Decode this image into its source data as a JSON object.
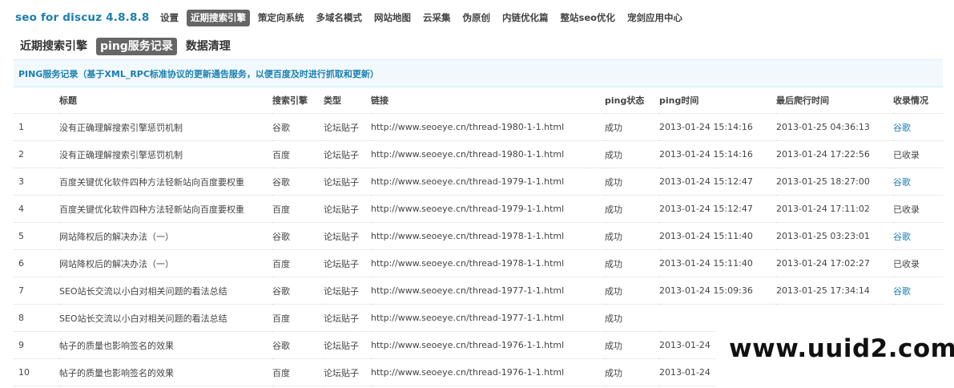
{
  "brand": "seo for discuz 4.8.8.8",
  "topnav": [
    "设置",
    "近期搜索引擎",
    "策定向系统",
    "多域名模式",
    "网站地图",
    "云采集",
    "伪原创",
    "内链优化篇",
    "整站seo优化",
    "宠剑应用中心"
  ],
  "topnav_active_index": 1,
  "subnav": [
    "近期搜索引擎",
    "ping服务记录",
    "数据清理"
  ],
  "subnav_active_index": 1,
  "info": "PING服务记录（基于XML_RPC标准协议的更新通告服务，以便百度及时进行抓取和更新）",
  "table": {
    "headers": {
      "idx": "",
      "title": "标题",
      "engine": "搜索引擎",
      "type": "类型",
      "link": "链接",
      "status": "ping状态",
      "ping_time": "ping时间",
      "crawl_time": "最后爬行时间",
      "recorded": "收录情况"
    },
    "rows": [
      {
        "idx": "1",
        "title": "没有正确理解搜索引擎惩罚机制",
        "engine": "谷歌",
        "type": "论坛贴子",
        "link": "http://www.seoeye.cn/thread-1980-1-1.html",
        "status": "成功",
        "ping_time": "2013-01-24 15:14:16",
        "crawl_time": "2013-01-25 04:36:13",
        "recorded": "谷歌"
      },
      {
        "idx": "2",
        "title": "没有正确理解搜索引擎惩罚机制",
        "engine": "百度",
        "type": "论坛贴子",
        "link": "http://www.seoeye.cn/thread-1980-1-1.html",
        "status": "成功",
        "ping_time": "2013-01-24 15:14:16",
        "crawl_time": "2013-01-24 17:22:56",
        "recorded": "已收录"
      },
      {
        "idx": "3",
        "title": "百度关键优化软件四种方法轻新站向百度要权重",
        "engine": "谷歌",
        "type": "论坛贴子",
        "link": "http://www.seoeye.cn/thread-1979-1-1.html",
        "status": "成功",
        "ping_time": "2013-01-24 15:12:47",
        "crawl_time": "2013-01-25 18:27:00",
        "recorded": "谷歌"
      },
      {
        "idx": "4",
        "title": "百度关键优化软件四种方法轻新站向百度要权重",
        "engine": "百度",
        "type": "论坛贴子",
        "link": "http://www.seoeye.cn/thread-1979-1-1.html",
        "status": "成功",
        "ping_time": "2013-01-24 15:12:47",
        "crawl_time": "2013-01-24 17:11:02",
        "recorded": "已收录"
      },
      {
        "idx": "5",
        "title": "网站降权后的解决办法（一）",
        "engine": "谷歌",
        "type": "论坛贴子",
        "link": "http://www.seoeye.cn/thread-1978-1-1.html",
        "status": "成功",
        "ping_time": "2013-01-24 15:11:40",
        "crawl_time": "2013-01-25 03:23:01",
        "recorded": "谷歌"
      },
      {
        "idx": "6",
        "title": "网站降权后的解决办法（一）",
        "engine": "百度",
        "type": "论坛贴子",
        "link": "http://www.seoeye.cn/thread-1978-1-1.html",
        "status": "成功",
        "ping_time": "2013-01-24 15:11:40",
        "crawl_time": "2013-01-24 17:02:27",
        "recorded": "已收录"
      },
      {
        "idx": "7",
        "title": "SEO站长交流以小白对相关问题的看法总结",
        "engine": "谷歌",
        "type": "论坛贴子",
        "link": "http://www.seoeye.cn/thread-1977-1-1.html",
        "status": "成功",
        "ping_time": "2013-01-24 15:09:36",
        "crawl_time": "2013-01-25 17:34:14",
        "recorded": "谷歌"
      },
      {
        "idx": "8",
        "title": "SEO站长交流以小白对相关问题的看法总结",
        "engine": "百度",
        "type": "论坛贴子",
        "link": "http://www.seoeye.cn/thread-1977-1-1.html",
        "status": "成功",
        "ping_time": "",
        "crawl_time": "",
        "recorded": ""
      },
      {
        "idx": "9",
        "title": "帖子的质量也影响签名的效果",
        "engine": "谷歌",
        "type": "论坛贴子",
        "link": "http://www.seoeye.cn/thread-1976-1-1.html",
        "status": "成功",
        "ping_time": "2013-01-24",
        "crawl_time": "",
        "recorded": ""
      },
      {
        "idx": "10",
        "title": "帖子的质量也影响签名的效果",
        "engine": "百度",
        "type": "论坛贴子",
        "link": "http://www.seoeye.cn/thread-1976-1-1.html",
        "status": "成功",
        "ping_time": "2013-01-24",
        "crawl_time": "",
        "recorded": ""
      }
    ]
  },
  "watermark": "www.uuid2.com",
  "colors": {
    "accent": "#1a7fb0",
    "active_tab_bg": "#666666",
    "info_bg": "#f2f9fd"
  }
}
